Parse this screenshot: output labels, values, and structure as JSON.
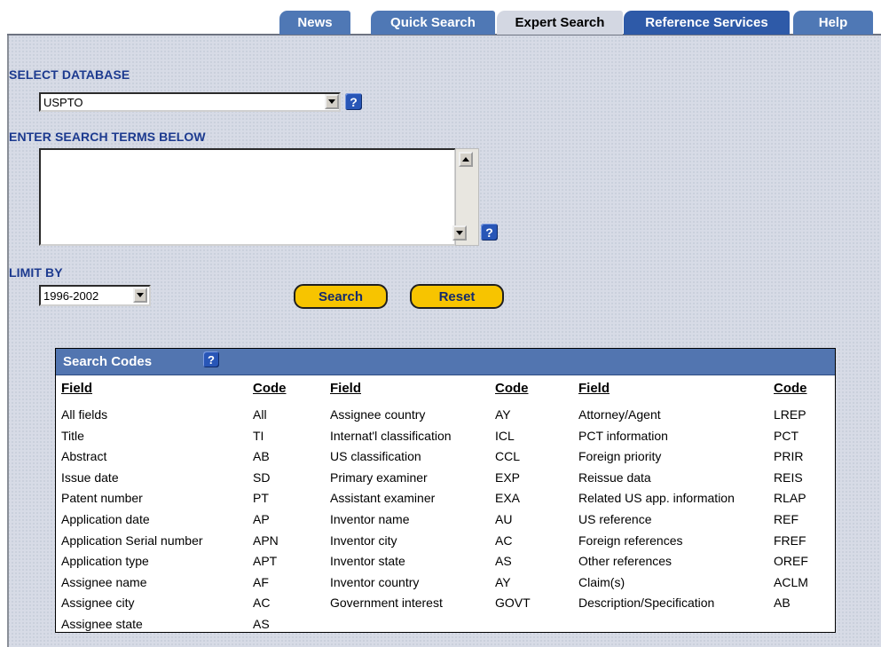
{
  "tabs": {
    "news": "News",
    "quick_search": "Quick Search",
    "expert_search": "Expert Search",
    "reference_services": "Reference Services",
    "help": "Help"
  },
  "select_database": {
    "label": "SELECT DATABASE",
    "selected": "USPTO"
  },
  "search_terms": {
    "label": "ENTER SEARCH TERMS BELOW",
    "value": ""
  },
  "limit_by": {
    "label": "LIMIT BY",
    "selected": "1996-2002"
  },
  "buttons": {
    "search": "Search",
    "reset": "Reset"
  },
  "help_glyph": "?",
  "search_codes": {
    "title": "Search Codes",
    "headers": [
      "Field",
      "Code",
      "Field",
      "Code",
      "Field",
      "Code"
    ],
    "columns": [
      [
        [
          "All fields",
          "All"
        ],
        [
          "Title",
          "TI"
        ],
        [
          "Abstract",
          "AB"
        ],
        [
          "Issue date",
          "SD"
        ],
        [
          "Patent number",
          "PT"
        ],
        [
          "Application date",
          "AP"
        ],
        [
          "Application Serial number",
          "APN"
        ],
        [
          "Application type",
          "APT"
        ],
        [
          "Assignee name",
          "AF"
        ],
        [
          "Assignee city",
          "AC"
        ],
        [
          "Assignee state",
          "AS"
        ]
      ],
      [
        [
          "Assignee country",
          "AY"
        ],
        [
          "Internat'l classification",
          "ICL"
        ],
        [
          "US classification",
          "CCL"
        ],
        [
          "Primary examiner",
          "EXP"
        ],
        [
          "Assistant examiner",
          "EXA"
        ],
        [
          "Inventor name",
          "AU"
        ],
        [
          "Inventor city",
          "AC"
        ],
        [
          "Inventor state",
          "AS"
        ],
        [
          "Inventor country",
          "AY"
        ],
        [
          "Government interest",
          "GOVT"
        ]
      ],
      [
        [
          "Attorney/Agent",
          "LREP"
        ],
        [
          "PCT information",
          "PCT"
        ],
        [
          "Foreign priority",
          "PRIR"
        ],
        [
          "Reissue data",
          "REIS"
        ],
        [
          "Related US app. information",
          "RLAP"
        ],
        [
          "US reference",
          "REF"
        ],
        [
          "Foreign references",
          "FREF"
        ],
        [
          "Other references",
          "OREF"
        ],
        [
          "Claim(s)",
          "ACLM"
        ],
        [
          "Description/Specification",
          "AB"
        ]
      ]
    ]
  },
  "colors": {
    "tab_blue": "#4f78b5",
    "label_blue": "#1c3a8f",
    "button_yellow": "#f7c400",
    "codes_header": "#5275b0"
  }
}
